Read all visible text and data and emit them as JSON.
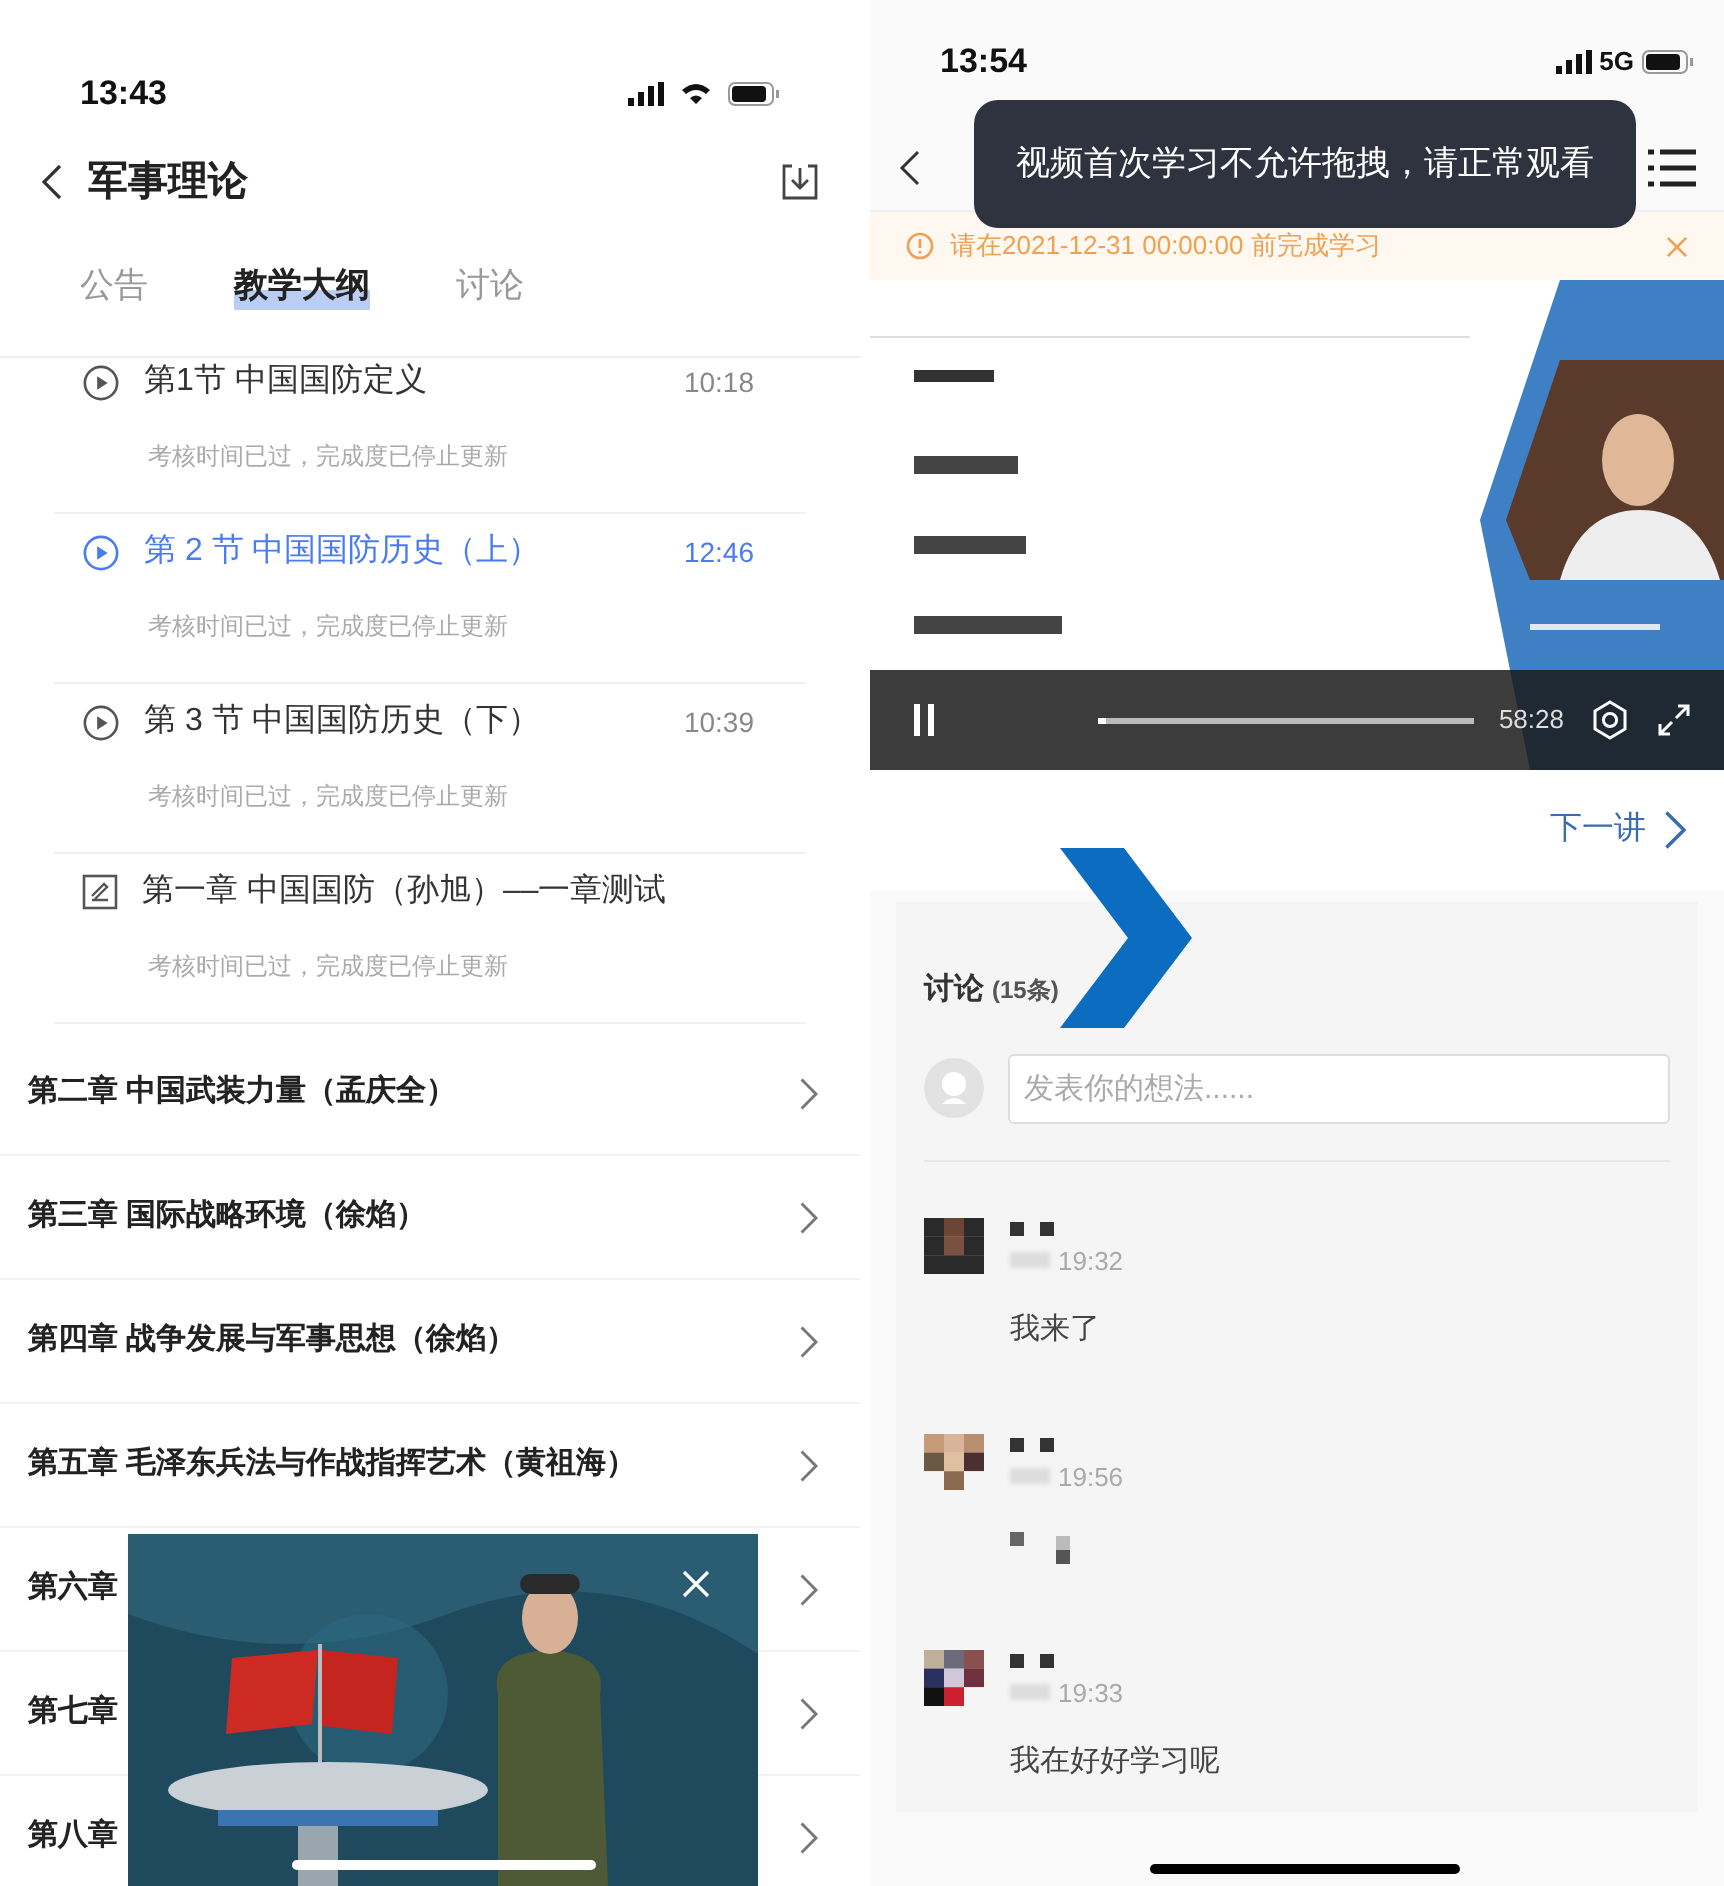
{
  "left_screen": {
    "status_bar": {
      "time": "13:43"
    },
    "header": {
      "title": "军事理论"
    },
    "tabs": [
      {
        "label": "公告",
        "selected": false
      },
      {
        "label": "教学大纲",
        "selected": true
      },
      {
        "label": "讨论",
        "selected": false
      }
    ],
    "sections": [
      {
        "kind": "video",
        "title": "第1节 中国国防定义",
        "duration": "10:18",
        "note": "考核时间已过，完成度已停止更新",
        "selected": false
      },
      {
        "kind": "video",
        "title": "第 2 节 中国国防历史（上）",
        "duration": "12:46",
        "note": "考核时间已过，完成度已停止更新",
        "selected": true
      },
      {
        "kind": "video",
        "title": "第 3 节 中国国防历史（下）",
        "duration": "10:39",
        "note": "考核时间已过，完成度已停止更新",
        "selected": false
      },
      {
        "kind": "quiz",
        "title": "第一章 中国国防（孙旭）––一章测试",
        "note": "考核时间已过，完成度已停止更新",
        "selected": false
      }
    ],
    "chapters": [
      {
        "title": "第二章 中国武装力量（孟庆全）"
      },
      {
        "title": "第三章 国际战略环境（徐焰）"
      },
      {
        "title": "第四章 战争发展与军事思想（徐焰）"
      },
      {
        "title": "第五章 毛泽东兵法与作战指挥艺术（黄祖海）"
      },
      {
        "title": "第六章"
      },
      {
        "title": "第七章"
      },
      {
        "title": "第八章"
      }
    ]
  },
  "right_screen": {
    "status_bar": {
      "time": "13:54",
      "network": "5G"
    },
    "toast": "视频首次学习不允许拖拽，请正常观看",
    "notice": "请在2021-12-31 00:00:00 前完成学习",
    "player": {
      "duration": "58:28",
      "level": 0.02
    },
    "next_link": "下一讲",
    "discussion": {
      "title": "讨论",
      "count": "(15条)",
      "placeholder": "发表你的想法......",
      "comments": [
        {
          "time": "19:32",
          "text": "我来了"
        },
        {
          "time": "19:56"
        },
        {
          "time": "19:33",
          "text": "我在好好学习呢"
        }
      ]
    }
  }
}
